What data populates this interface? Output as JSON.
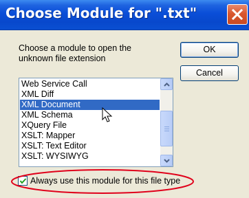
{
  "dialog": {
    "title": "Choose Module for \".txt\"",
    "instruction": "Choose a module to open the unknown file extension",
    "ok_label": "OK",
    "cancel_label": "Cancel"
  },
  "module_list": {
    "items": [
      "Web Service Call",
      "XML Diff",
      "XML Document",
      "XML Schema",
      "XQuery File",
      "XSLT: Mapper",
      "XSLT: Text Editor",
      "XSLT: WYSIWYG"
    ],
    "selected": "XML Document"
  },
  "always_use": {
    "label": "Always use this module for this file type",
    "checked": true,
    "highlight_color": "#e0001a"
  },
  "colors": {
    "titlebar": "#0a4ed8",
    "selection": "#316ac5",
    "dialog_bg": "#ece9d8"
  },
  "icons": [
    "close-icon",
    "scroll-up-icon",
    "scroll-down-icon",
    "mouse-cursor-icon",
    "checkmark-icon"
  ]
}
